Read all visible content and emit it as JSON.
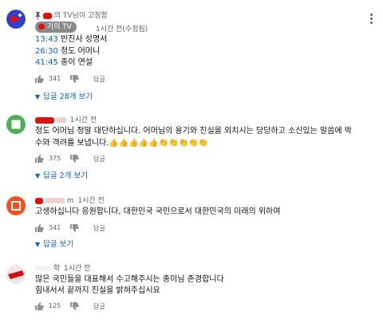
{
  "comments": [
    {
      "pinned_label": "의 TV님이 고정함",
      "author_badge": "기의 TV",
      "time": "1시간 전(수정됨)",
      "lines": [
        {
          "ts": "13:43",
          "text": " 반진사 성명서"
        },
        {
          "ts": "26:30",
          "text": " 청도 어머니"
        },
        {
          "ts": "41:45",
          "text": " 종이 연설"
        }
      ],
      "likes": "341",
      "reply_label": "답글",
      "replies_label": "답글 28개 보기"
    },
    {
      "author_suffix": "",
      "time": "1시간 전",
      "lines": [
        {
          "text": "청도 어머님 정말 대단하십니다. 어머님의 용기와 진실을 외치시는 당당하고 소신있는 말씀에 박"
        },
        {
          "text": "수와 격려를 보냅니다.👍👍👍👍👍👏👏👏👏👏"
        }
      ],
      "likes": "375",
      "reply_label": "답글",
      "replies_label": "답글 2개 보기"
    },
    {
      "author_suffix": "m",
      "time": "1시간 전",
      "lines": [
        {
          "text": "고생하십니다  응원합니다,  대한민국 국민으로서  대한민국의 미래의 위하여"
        }
      ],
      "likes": "341",
      "reply_label": "답글",
      "replies_label": "답글 보기"
    },
    {
      "author_suffix": "학",
      "time": "1시간 전",
      "lines": [
        {
          "text": "많은 국민들을 대표해서 수고해주시는 종이님 존경합니다"
        },
        {
          "text": "힘내서서 끝까지 진실을 밝혀주십시요"
        }
      ],
      "likes": "125",
      "reply_label": "답글"
    }
  ],
  "colors": {
    "link": "#065fd4",
    "text": "#0f0f0f",
    "meta": "#606060"
  }
}
